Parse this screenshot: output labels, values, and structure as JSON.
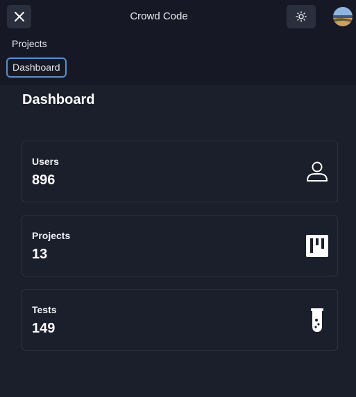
{
  "header": {
    "app_title": "Crowd Code",
    "close_icon": "close-icon",
    "theme_icon": "sun-icon",
    "avatar_icon": "avatar"
  },
  "nav": {
    "items": [
      {
        "label": "Projects"
      },
      {
        "label": "Dashboard",
        "active": true
      }
    ]
  },
  "main": {
    "title": "Dashboard",
    "cards": [
      {
        "label": "Users",
        "value": "896",
        "icon": "user-icon"
      },
      {
        "label": "Projects",
        "value": "13",
        "icon": "kanban-board-icon"
      },
      {
        "label": "Tests",
        "value": "149",
        "icon": "test-tube-icon"
      }
    ]
  },
  "colors": {
    "background": "#1b1e2b",
    "topbar": "#161925",
    "button_bg": "#2b2f3d",
    "active_border": "#5b8fc7",
    "card_border": "#2e3240"
  }
}
